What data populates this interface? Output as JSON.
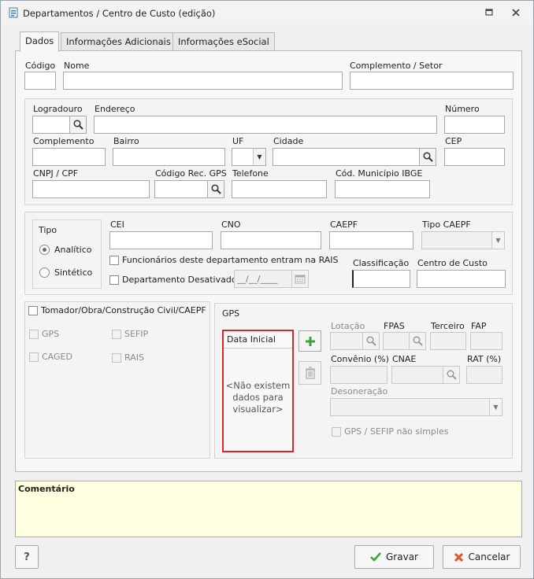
{
  "window": {
    "title": "Departamentos / Centro de Custo (edição)",
    "icons": {
      "app": "form-icon",
      "restore": "restore-icon",
      "close": "close-icon"
    }
  },
  "tabs": [
    {
      "label": "Dados",
      "active": true
    },
    {
      "label": "Informações Adicionais",
      "active": false
    },
    {
      "label": "Informações eSocial",
      "active": false
    }
  ],
  "main": {
    "codigo": {
      "label": "Código",
      "value": ""
    },
    "nome": {
      "label": "Nome",
      "value": ""
    },
    "complemento_setor": {
      "label": "Complemento / Setor",
      "value": ""
    }
  },
  "address": {
    "logradouro": {
      "label": "Logradouro",
      "value": ""
    },
    "endereco": {
      "label": "Endereço",
      "value": ""
    },
    "numero": {
      "label": "Número",
      "value": ""
    },
    "complemento": {
      "label": "Complemento",
      "value": ""
    },
    "bairro": {
      "label": "Bairro",
      "value": ""
    },
    "uf": {
      "label": "UF",
      "value": ""
    },
    "cidade": {
      "label": "Cidade",
      "value": ""
    },
    "cep": {
      "label": "CEP",
      "value": ""
    },
    "cnpj_cpf": {
      "label": "CNPJ / CPF",
      "value": ""
    },
    "codigo_rec_gps": {
      "label": "Código Rec. GPS",
      "value": ""
    },
    "telefone": {
      "label": "Telefone",
      "value": ""
    },
    "cod_municipio_ibge": {
      "label": "Cód. Município IBGE",
      "value": ""
    }
  },
  "tipo": {
    "legend": "Tipo",
    "options": [
      {
        "label": "Analítico",
        "selected": true
      },
      {
        "label": "Sintético",
        "selected": false
      }
    ]
  },
  "ids": {
    "cei": {
      "label": "CEI",
      "value": ""
    },
    "cno": {
      "label": "CNO",
      "value": ""
    },
    "caepf": {
      "label": "CAEPF",
      "value": ""
    },
    "tipo_caepf": {
      "label": "Tipo CAEPF",
      "value": ""
    },
    "rais_check": {
      "label": "Funcionários deste departamento entram na RAIS",
      "checked": false
    },
    "desativado_check": {
      "label": "Departamento Desativado",
      "checked": false
    },
    "desativado_date": {
      "placeholder": "__/__/____"
    },
    "classificacao": {
      "label": "Classificação",
      "value": ""
    },
    "centro_custo": {
      "label": "Centro de Custo",
      "value": ""
    }
  },
  "tomador": {
    "label": "Tomador/Obra/Construção Civil/CAEPF",
    "checks": [
      {
        "label": "GPS"
      },
      {
        "label": "SEFIP"
      },
      {
        "label": "CAGED"
      },
      {
        "label": "RAIS"
      }
    ]
  },
  "gps": {
    "legend": "GPS",
    "grid_header": "Data Inicial",
    "no_data": "<Não existem dados para visualizar>",
    "no_data_lines": [
      "<Não existem",
      "dados para",
      "visualizar>"
    ],
    "add_icon": "plus-icon",
    "delete_icon": "trash-icon",
    "lotacao": {
      "label": "Lotação",
      "value": ""
    },
    "fpas": {
      "label": "FPAS",
      "value": ""
    },
    "terceiro": {
      "label": "Terceiro",
      "value": ""
    },
    "fap": {
      "label": "FAP",
      "value": ""
    },
    "convenio": {
      "label": "Convênio (%)",
      "value": ""
    },
    "cnae": {
      "label": "CNAE",
      "value": ""
    },
    "rat": {
      "label": "RAT (%)",
      "value": ""
    },
    "desoneracao": {
      "label": "Desoneração",
      "value": ""
    },
    "nao_simples": {
      "label": "GPS / SEFIP não simples",
      "checked": false
    }
  },
  "comment": {
    "label": "Comentário",
    "value": ""
  },
  "footer": {
    "help": "?",
    "gravar": "Gravar",
    "cancelar": "Cancelar",
    "gravar_icon": "check-icon",
    "cancelar_icon": "x-icon"
  },
  "colors": {
    "highlight_border": "#d9242a",
    "comment_bg": "#ffffe1",
    "add_green": "#3aa53a",
    "cancel_red": "#e2522b"
  }
}
